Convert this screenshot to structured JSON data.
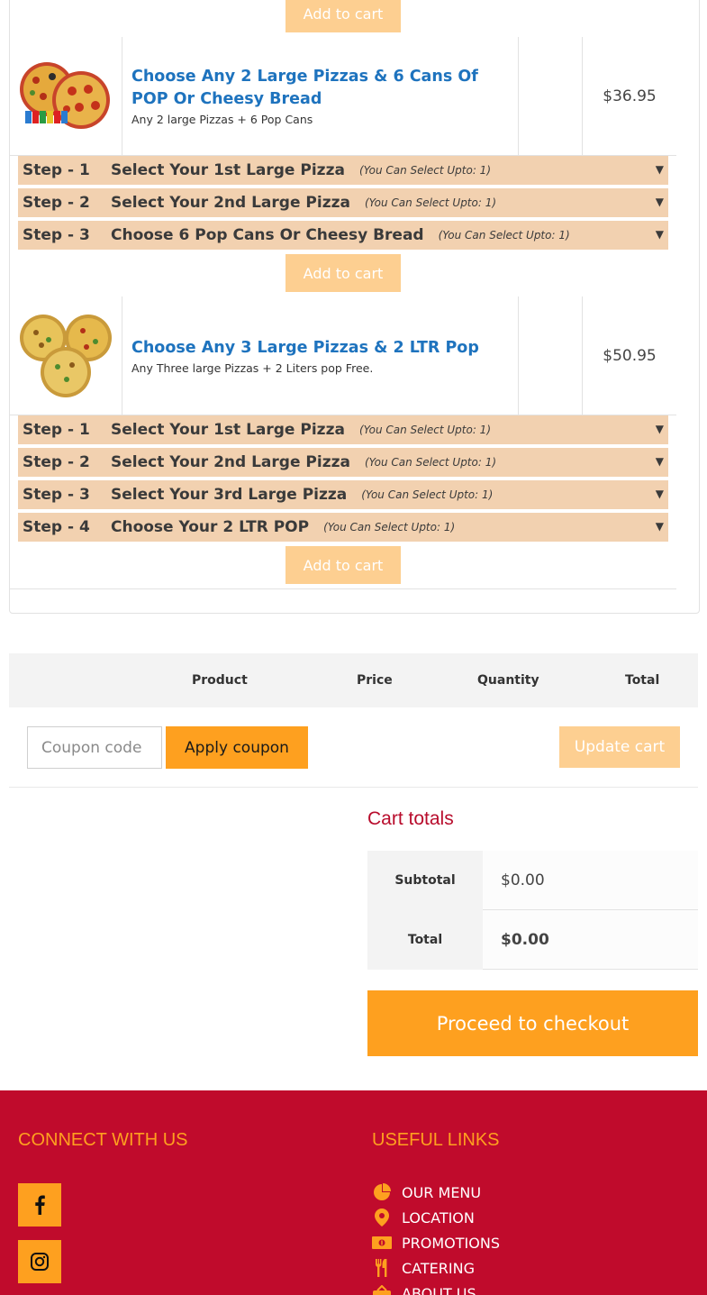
{
  "products": [
    {
      "title": "Choose Any 2 Large Pizzas & 6 Cans Of POP Or Cheesy Bread",
      "description": "Any 2 large Pizzas + 6 Pop Cans",
      "price": "$36.95",
      "steps": [
        {
          "num": "Step - 1",
          "title": "Select Your 1st Large Pizza",
          "note": "(You Can Select Upto: 1)"
        },
        {
          "num": "Step - 2",
          "title": "Select Your 2nd Large Pizza",
          "note": "(You Can Select Upto: 1)"
        },
        {
          "num": "Step - 3",
          "title": "Choose 6 Pop Cans Or Cheesy Bread",
          "note": "(You Can Select Upto: 1)"
        }
      ]
    },
    {
      "title": "Choose Any 3 Large Pizzas & 2 LTR Pop",
      "description": "Any Three large Pizzas + 2 Liters pop Free.",
      "price": "$50.95",
      "steps": [
        {
          "num": "Step - 1",
          "title": "Select Your 1st Large Pizza",
          "note": "(You Can Select Upto: 1)"
        },
        {
          "num": "Step - 2",
          "title": "Select Your 2nd Large Pizza",
          "note": "(You Can Select Upto: 1)"
        },
        {
          "num": "Step - 3",
          "title": "Select Your 3rd Large Pizza",
          "note": "(You Can Select Upto: 1)"
        },
        {
          "num": "Step - 4",
          "title": "Choose Your 2 LTR POP",
          "note": "(You Can Select Upto: 1)"
        }
      ]
    }
  ],
  "add_to_cart_label": "Add to cart",
  "step_arrow": "▼",
  "cart_table": {
    "headers": {
      "product": "Product",
      "price": "Price",
      "quantity": "Quantity",
      "total": "Total"
    },
    "coupon_placeholder": "Coupon code",
    "apply_coupon_label": "Apply coupon",
    "update_cart_label": "Update cart"
  },
  "cart_totals": {
    "title": "Cart totals",
    "subtotal_label": "Subtotal",
    "subtotal_value": "$0.00",
    "total_label": "Total",
    "total_value": "$0.00",
    "checkout_label": "Proceed to checkout"
  },
  "footer": {
    "connect_heading": "CONNECT WITH US",
    "links_heading": "USEFUL LINKS",
    "social": [
      "facebook-icon",
      "instagram-icon"
    ],
    "links": [
      {
        "label": "OUR MENU",
        "icon": "menu-pie-icon"
      },
      {
        "label": "LOCATION",
        "icon": "location-pin-icon"
      },
      {
        "label": "PROMOTIONS",
        "icon": "money-bill-icon"
      },
      {
        "label": "CATERING",
        "icon": "utensils-icon"
      },
      {
        "label": "ABOUT US",
        "icon": "about-icon"
      }
    ]
  },
  "colors": {
    "accent": "#fea01f",
    "accent_light": "#fdcf91",
    "brand_red": "#c00b2c",
    "link_blue": "#1e73be",
    "step_bg": "#f2d1b0"
  }
}
